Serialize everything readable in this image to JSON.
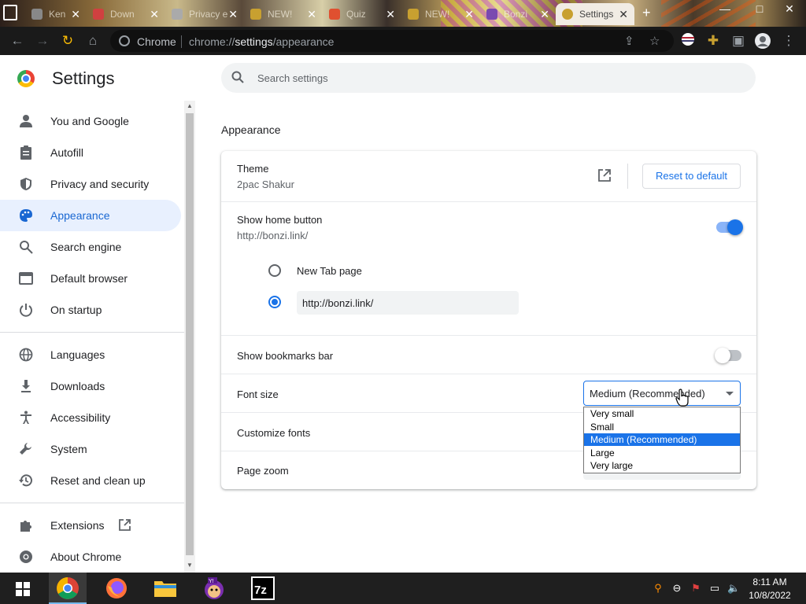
{
  "browser": {
    "tabs": [
      {
        "title": "Ken"
      },
      {
        "title": "Down"
      },
      {
        "title": "Privacy e"
      },
      {
        "title": "NEW!"
      },
      {
        "title": "Quiz"
      },
      {
        "title": "NEW!"
      },
      {
        "title": "Bonzi"
      },
      {
        "title": "Settings",
        "active": true
      }
    ],
    "new_tab_label": "+",
    "window_controls": [
      "—",
      "□",
      "✕"
    ],
    "omnibox": {
      "site_label": "Chrome",
      "url_prefix": "chrome://",
      "url_bold": "settings",
      "url_suffix": "/appearance"
    }
  },
  "settings": {
    "title": "Settings",
    "search": {
      "placeholder": "Search settings"
    },
    "sidebar": {
      "items": [
        {
          "label": "You and Google",
          "icon": "person-icon"
        },
        {
          "label": "Autofill",
          "icon": "clipboard-icon"
        },
        {
          "label": "Privacy and security",
          "icon": "shield-icon"
        },
        {
          "label": "Appearance",
          "icon": "palette-icon",
          "selected": true
        },
        {
          "label": "Search engine",
          "icon": "search-icon"
        },
        {
          "label": "Default browser",
          "icon": "browser-window-icon"
        },
        {
          "label": "On startup",
          "icon": "power-icon"
        },
        {
          "label": "Languages",
          "icon": "globe-icon"
        },
        {
          "label": "Downloads",
          "icon": "download-icon"
        },
        {
          "label": "Accessibility",
          "icon": "accessibility-icon"
        },
        {
          "label": "System",
          "icon": "wrench-icon"
        },
        {
          "label": "Reset and clean up",
          "icon": "history-icon"
        },
        {
          "label": "Extensions",
          "icon": "puzzle-icon"
        },
        {
          "label": "About Chrome",
          "icon": "chrome-icon"
        }
      ]
    },
    "appearance": {
      "section_title": "Appearance",
      "theme": {
        "label": "Theme",
        "value": "2pac Shakur",
        "reset_label": "Reset to default"
      },
      "home_button": {
        "label": "Show home button",
        "value": "http://bonzi.link/",
        "enabled": true,
        "options": [
          "New Tab page"
        ],
        "custom_url": "http://bonzi.link/",
        "selected_option": "custom"
      },
      "bookmarks_bar": {
        "label": "Show bookmarks bar",
        "enabled": false
      },
      "font_size": {
        "label": "Font size",
        "selected": "Medium (Recommended)",
        "options": [
          "Very small",
          "Small",
          "Medium (Recommended)",
          "Large",
          "Very large"
        ],
        "highlighted_index": 2,
        "open": true
      },
      "customize_fonts": {
        "label": "Customize fonts"
      },
      "page_zoom": {
        "label": "Page zoom"
      }
    }
  },
  "taskbar": {
    "apps": [
      "start-icon",
      "chrome-icon",
      "firefox-icon",
      "file-explorer-icon",
      "bonzi-buddy-icon",
      "7zip-icon"
    ],
    "clock_time": "8:11 AM",
    "clock_date": "10/8/2022"
  }
}
